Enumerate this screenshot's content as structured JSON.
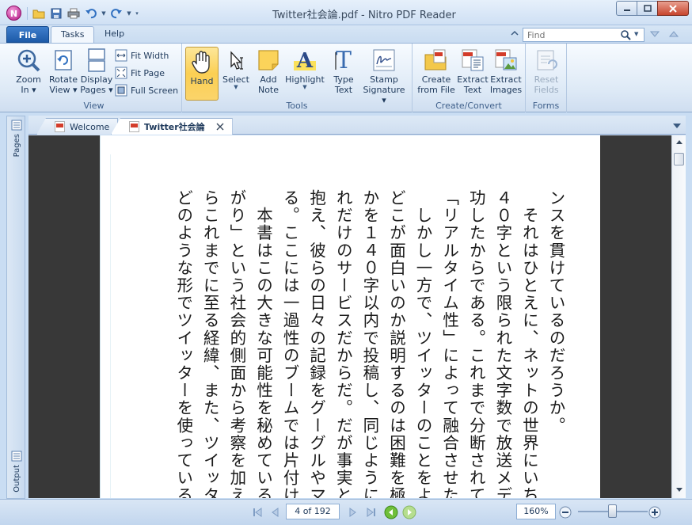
{
  "window": {
    "title": "Twitter社会論.pdf - Nitro PDF Reader",
    "logo_letter": "N"
  },
  "ribbon_tabs": {
    "file": "File",
    "tasks": "Tasks",
    "help": "Help"
  },
  "find": {
    "placeholder": "Find"
  },
  "groups": {
    "view": {
      "label": "View",
      "zoom_in": [
        "Zoom",
        "In"
      ],
      "rotate_view": [
        "Rotate",
        "View"
      ],
      "display_pages": [
        "Display",
        "Pages"
      ],
      "fit_width": "Fit Width",
      "fit_page": "Fit Page",
      "full_screen": "Full Screen"
    },
    "tools": {
      "label": "Tools",
      "hand": "Hand",
      "select": "Select",
      "add_note": [
        "Add",
        "Note"
      ],
      "highlight": "Highlight",
      "type_text": [
        "Type",
        "Text"
      ],
      "stamp_signature": [
        "Stamp",
        "Signature"
      ]
    },
    "create_convert": {
      "label": "Create/Convert",
      "create_from_file": [
        "Create",
        "from File"
      ],
      "extract_text": [
        "Extract",
        "Text"
      ],
      "extract_images": [
        "Extract",
        "Images"
      ]
    },
    "forms": {
      "label": "Forms",
      "reset_fields": [
        "Reset",
        "Fields"
      ]
    }
  },
  "side_panels": {
    "pages": "Pages",
    "output": "Output"
  },
  "doc_tabs": [
    {
      "label": "Welcome",
      "active": false
    },
    {
      "label": "Twitter社会論",
      "active": true
    }
  ],
  "document": {
    "lines": [
      "ンスを貫けているのだろうか。",
      "　それはひとえに、ネットの世界にいち早",
      "４０字という限られた文字数で放送メディ",
      "功したからである。これまで分断されて",
      "「リアルタイム性」によって融合させたツ",
      "　しかし一方で、ツイッターのことをよく",
      "どこが面白いのか説明するのは困難を極め",
      "かを１４０字以内で投稿し、同じように投",
      "れだけのサービスだからだ。だが事実と",
      "抱え、彼らの日々の記録をグーグルやマイ",
      "る。ここには一過性のブームでは片付けら",
      "　本書はこの大きな可能性を秘めているツ",
      "がり」という社会的側面から考察を加えた",
      "らこれまでに至る経緯、また、ツイッター",
      "どのような形でツイッターを使っているの"
    ]
  },
  "status": {
    "page_indicator": "4 of 192",
    "zoom": "160%",
    "zoom_slider_fraction": 0.5
  },
  "colors": {
    "file_tab": "#1d5aa8",
    "active_tool": "#fbcf53",
    "viewport_bg": "#383838",
    "ribbon_bg": "#dde9f6"
  }
}
